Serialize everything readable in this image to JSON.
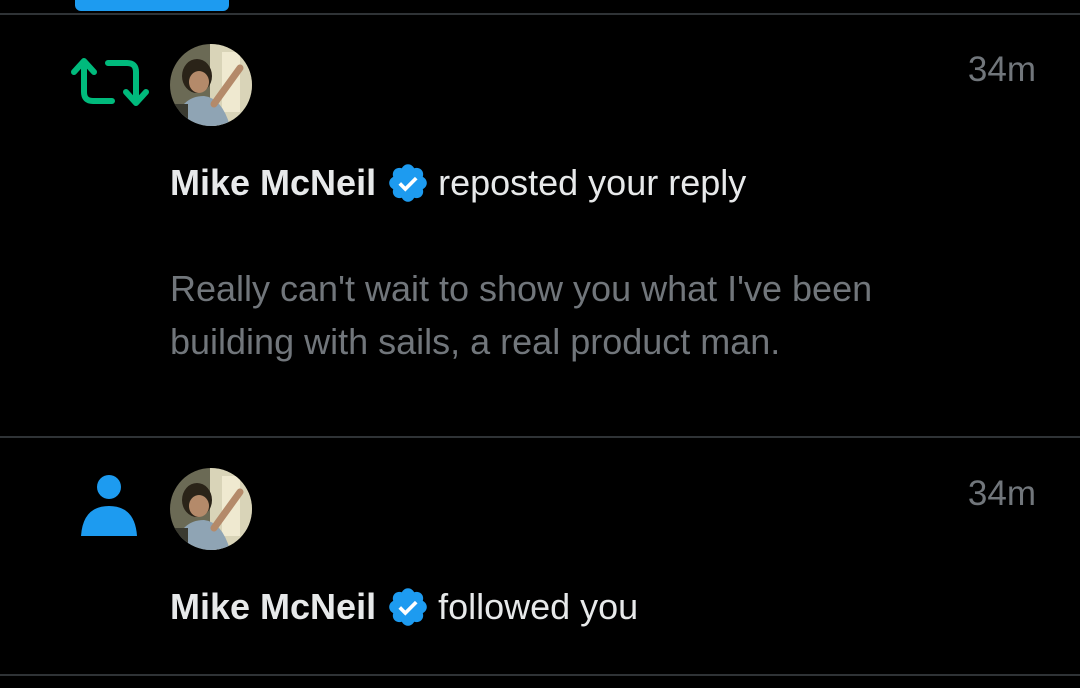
{
  "colors": {
    "background": "#000000",
    "accent": "#1d9bf0",
    "repost_green": "#00ba7c",
    "secondary_text": "#71767b",
    "primary_text": "#e7e9ea",
    "divider": "#2f3336"
  },
  "notifications": [
    {
      "type_icon": "repost-icon",
      "avatar": "user-avatar",
      "time": "34m",
      "user_name": "Mike McNeil",
      "verified": true,
      "action": "reposted your reply",
      "snippet": "Really can't wait to show you what I've been building with sails, a real product man."
    },
    {
      "type_icon": "person-icon",
      "avatar": "user-avatar",
      "time": "34m",
      "user_name": "Mike McNeil",
      "verified": true,
      "action": "followed you"
    }
  ]
}
